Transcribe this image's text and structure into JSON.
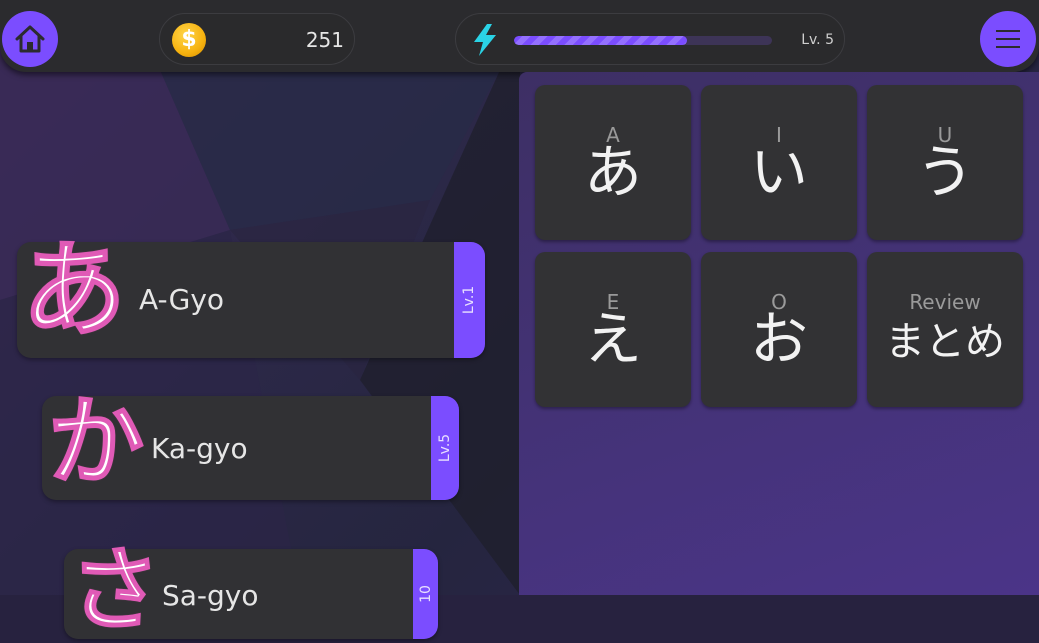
{
  "header": {
    "coins": "251",
    "xp_progress": 0.67,
    "level": "Lv. 5"
  },
  "lessons": [
    {
      "kana": "あ",
      "name": "A-Gyo",
      "level": "Lv.1"
    },
    {
      "kana": "か",
      "name": "Ka-gyo",
      "level": "Lv.5"
    },
    {
      "kana": "さ",
      "name": "Sa-gyo",
      "level": "10"
    }
  ],
  "tiles": [
    {
      "romaji": "A",
      "kana": "あ"
    },
    {
      "romaji": "I",
      "kana": "い"
    },
    {
      "romaji": "U",
      "kana": "う"
    },
    {
      "romaji": "E",
      "kana": "え"
    },
    {
      "romaji": "O",
      "kana": "お"
    },
    {
      "romaji": "Review",
      "kana": "まとめ"
    }
  ],
  "colors": {
    "accent": "#7b4dff",
    "topbar": "#2b2b2e",
    "card": "#313134",
    "kana_outline": "#e05ab6",
    "bolt": "#2ad3e6"
  },
  "icons": {
    "home": "home-icon",
    "menu": "hamburger-menu-icon",
    "coin": "coin-icon",
    "energy": "lightning-bolt-icon"
  }
}
